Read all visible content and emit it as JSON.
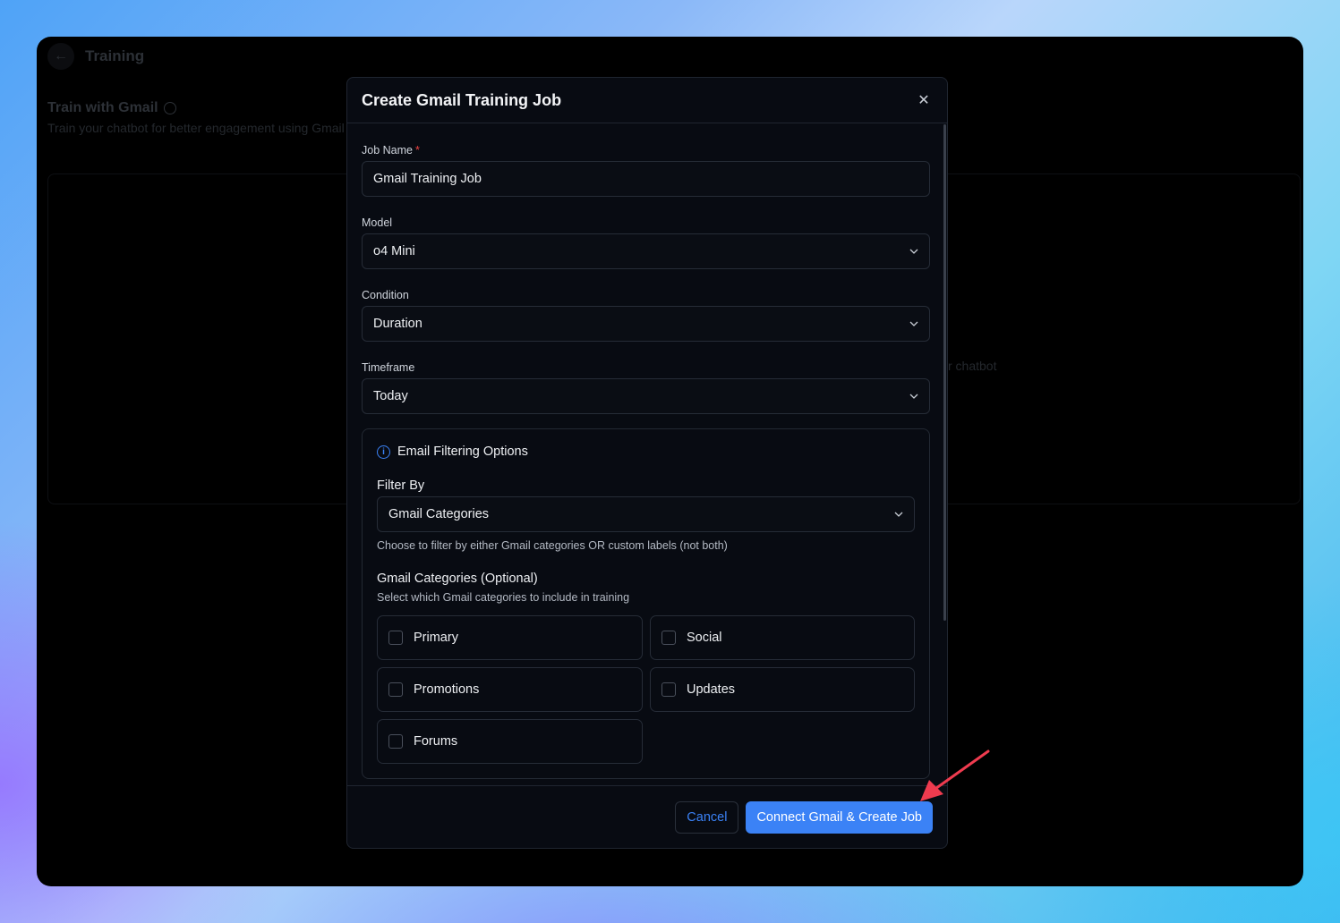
{
  "background_page": {
    "title": "Training",
    "section_title": "Train with Gmail",
    "section_subtitle": "Train your chatbot for better engagement using Gmail",
    "card_text": "r chatbot"
  },
  "modal": {
    "title": "Create Gmail Training Job",
    "job_name": {
      "label": "Job Name",
      "required_mark": "*",
      "value": "Gmail Training Job"
    },
    "model": {
      "label": "Model",
      "value": "o4 Mini"
    },
    "condition": {
      "label": "Condition",
      "value": "Duration"
    },
    "timeframe": {
      "label": "Timeframe",
      "value": "Today"
    },
    "filtering": {
      "title": "Email Filtering Options",
      "filter_by_label": "Filter By",
      "filter_by_value": "Gmail Categories",
      "filter_hint": "Choose to filter by either Gmail categories OR custom labels (not both)",
      "categories_title": "Gmail Categories (Optional)",
      "categories_hint": "Select which Gmail categories to include in training",
      "categories": [
        {
          "label": "Primary",
          "checked": false
        },
        {
          "label": "Social",
          "checked": false
        },
        {
          "label": "Promotions",
          "checked": false
        },
        {
          "label": "Updates",
          "checked": false
        },
        {
          "label": "Forums",
          "checked": false
        }
      ]
    },
    "footer": {
      "cancel_label": "Cancel",
      "submit_label": "Connect Gmail & Create Job"
    }
  },
  "colors": {
    "accent": "#3b82f6",
    "required": "#ef4444",
    "annotation_arrow": "#ef3b4f"
  }
}
